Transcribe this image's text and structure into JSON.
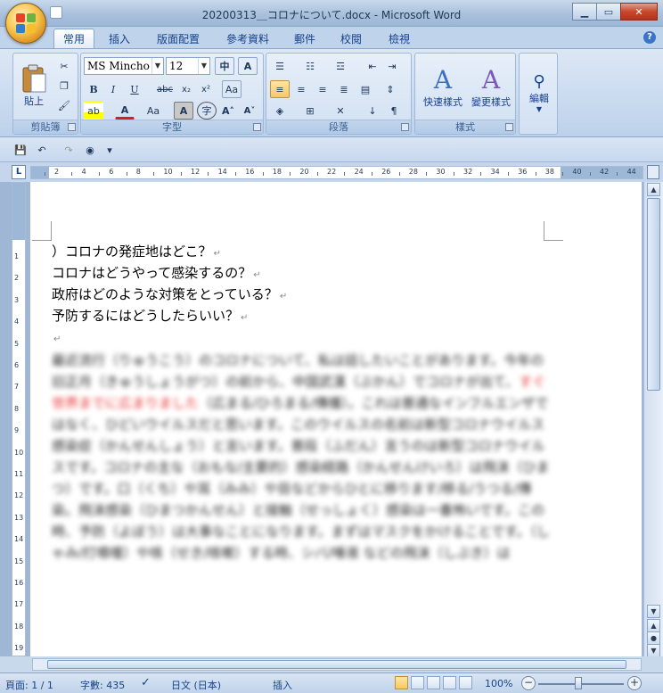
{
  "window": {
    "title": "20200313＿コロナについて.docx - Microsoft Word"
  },
  "tabs": [
    "常用",
    "插入",
    "版面配置",
    "參考資料",
    "郵件",
    "校閱",
    "檢視"
  ],
  "ribbon": {
    "clipboard": {
      "paste_label": "貼上",
      "group_label": "剪貼簿"
    },
    "font": {
      "font_name": "MS Mincho",
      "font_size": "12",
      "group_label": "字型"
    },
    "paragraph": {
      "group_label": "段落"
    },
    "styles": {
      "quick_styles_label": "快速樣式",
      "change_styles_label": "變更樣式",
      "group_label": "樣式"
    },
    "editing": {
      "label": "編輯"
    }
  },
  "ruler": {
    "numbers": [
      "2",
      "4",
      "6",
      "8",
      "10",
      "12",
      "14",
      "16",
      "18",
      "20",
      "22",
      "24",
      "26",
      "28",
      "30",
      "32",
      "34",
      "36",
      "38",
      "40",
      "42",
      "44"
    ]
  },
  "vruler": {
    "numbers": [
      "1",
      "2",
      "3",
      "4",
      "5",
      "6",
      "7",
      "8",
      "9",
      "10",
      "11",
      "12",
      "13",
      "14",
      "15",
      "16",
      "17",
      "18",
      "19"
    ]
  },
  "document": {
    "lines": [
      "）コロナの発症地はどこ？",
      "コロナはどうやって感染するの？",
      "政府はどのような対策をとっている？",
      "予防するにはどうしたらいい？"
    ],
    "paragraph_mark": "↵",
    "blurred_paragraphs": [
      "最近流行（りゅうこう）のコロナについて、私は話したいことがあります。今年の旧正月（きゅうしょうがつ）の前から、中国武漢（ぶかん）でコロナが出て、",
      "すぐ世界までに広まりました",
      "（広まる/ひろまる/傳播）。これは普通なインフルエンザではなく、ひどいウイルスだと思います。このウイルスの名前は新型コロナウイルス感染症（かんせんしょう）と言います。普段（ふだん）言うのは新型コロナウイルスです。コロナの主な（おもな/主要的）感染経路（かんせんけいろ）は飛沫（ひまつ）です。口（くち）や耳（みみ）や目などからひとに移ります/移る/うつる/傳染。飛沫感染（ひまつかんせん）と接触（せっしょく）感染は一番怖いです。この時、予防（よぼう）は大事なことになります。まずはマスクをかけることです。（しゃみ/打噴嚏）や咳（せき/咳嗽）する時、シバ/唾液 などの飛沫（しぶき）は"
    ]
  },
  "status": {
    "page": "頁面: 1 / 1",
    "words": "字數: 435",
    "language": "日文 (日本)",
    "mode": "插入",
    "zoom": "100%"
  }
}
